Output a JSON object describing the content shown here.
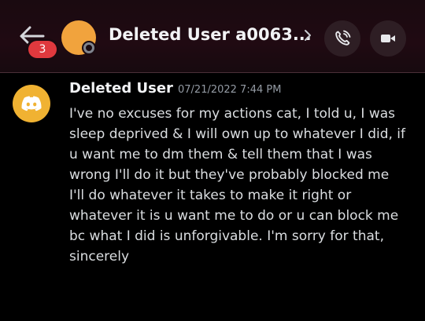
{
  "header": {
    "back_badge": "3",
    "title": "Deleted User a0063...",
    "avatar_color": "#f1a33d",
    "status": "offline"
  },
  "icons": {
    "back": "arrow-left-icon",
    "chevron": "chevron-right-icon",
    "call": "phone-call-icon",
    "video": "video-camera-icon",
    "avatar_logo": "discord-logo-icon"
  },
  "message": {
    "username": "Deleted User",
    "timestamp": "07/21/2022 7:44 PM",
    "avatar_color": "#f0b232",
    "lines": [
      "I've no excuses for my actions cat, I told u, I was sleep deprived & I will own up to whatever I did, if u want me to dm them & tell them that I was wrong I'll do it but they've probably blocked me",
      "I'll do whatever it takes to make it right or whatever it is u want me to do or u can block me bc what I did is unforgivable. I'm sorry for that, sincerely"
    ]
  },
  "colors": {
    "background": "#000000",
    "header_bg": "#1a0a10",
    "badge": "#e0393e",
    "text": "#dbdee1",
    "muted": "#949ba4"
  }
}
